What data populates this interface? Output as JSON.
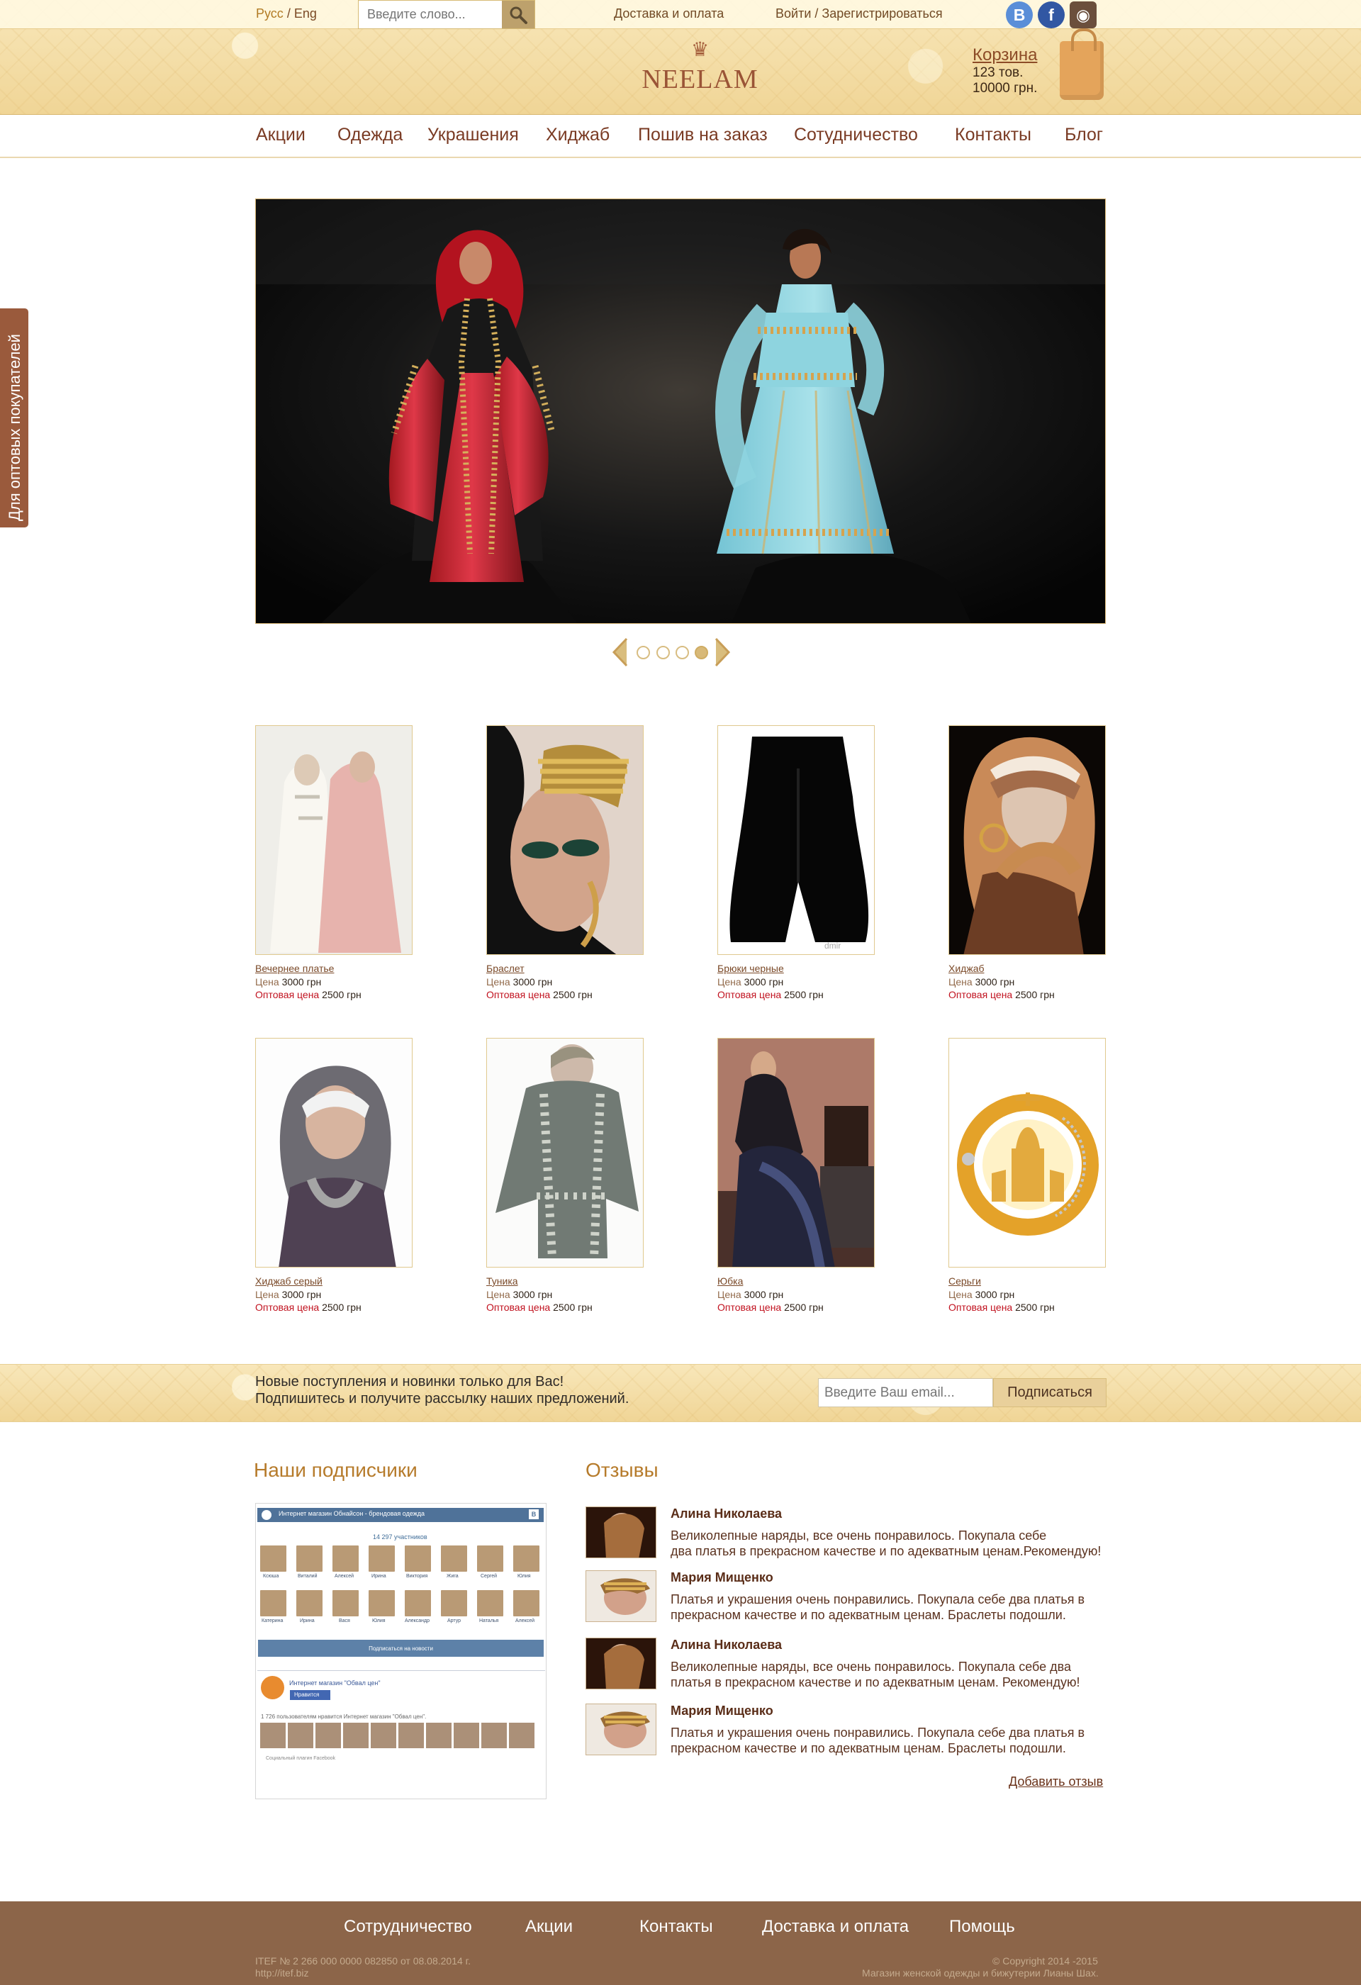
{
  "language": {
    "ru": "Русс",
    "separator": "/",
    "en": "Eng"
  },
  "search": {
    "placeholder": "Введите слово..."
  },
  "topbar": {
    "delivery": "Доставка и оплата",
    "auth": "Войти / Зарегистрироваться",
    "social": [
      {
        "label": "B",
        "color": "#5a8ed8"
      },
      {
        "label": "f",
        "color": "#3157a3"
      },
      {
        "label": "◉",
        "color": "#6b4f3c"
      }
    ]
  },
  "brand": {
    "name": "NEELAM",
    "crown_glyph": "♛"
  },
  "cart": {
    "title": "Корзина",
    "items": "123 тов.",
    "total": "10000 грн."
  },
  "nav": [
    "Акции",
    "Одежда",
    "Украшения",
    "Хиджаб",
    "Пошив на заказ",
    "Сотудничество",
    "Контакты",
    "Блог"
  ],
  "side_tab": {
    "label": "Для оптовых покупателей"
  },
  "slider": {
    "dots_count": 4,
    "active_index": 3
  },
  "product_labels": {
    "price": "Цена",
    "wholesale": "Оптовая цена"
  },
  "products": [
    {
      "name": "Вечернее платье",
      "price": "3000 грн",
      "wholesale_price": "2500 грн"
    },
    {
      "name": "Браслет",
      "price": "3000 грн",
      "wholesale_price": "2500 грн"
    },
    {
      "name": "Брюки черные",
      "price": "3000 грн",
      "wholesale_price": "2500 грн"
    },
    {
      "name": "Хиджаб",
      "price": "3000 грн",
      "wholesale_price": "2500 грн"
    },
    {
      "name": "Хиджаб серый",
      "price": "3000 грн",
      "wholesale_price": "2500 грн"
    },
    {
      "name": "Туника",
      "price": "3000 грн",
      "wholesale_price": "2500 грн"
    },
    {
      "name": "Юбка",
      "price": "3000 грн",
      "wholesale_price": "2500 грн"
    },
    {
      "name": "Серьги",
      "price": "3000 грн",
      "wholesale_price": "2500 грн"
    }
  ],
  "subscribe": {
    "line1": "Новые поступления и новинки только для Вас!",
    "line2": "Подпишитесь и получите рассылку наших предложений.",
    "placeholder": "Введите Ваш email...",
    "button": "Подписаться"
  },
  "subscribers": {
    "title": "Наши подписчики",
    "vk": {
      "title": "Интернет магазин Обнайсон - брендовая одежда",
      "count": "14 297 участников",
      "members": [
        "Ксюша",
        "Виталий",
        "Алексей",
        "Ирина",
        "Виктория",
        "Жига",
        "Сергей",
        "Юлия",
        "Катерина",
        "Ирина",
        "Вася",
        "Юлия",
        "Александр",
        "Артур",
        "Наталья",
        "Алексей"
      ],
      "button": "Подписаться на новости"
    },
    "fb": {
      "title": "Интернет магазин \"Обвал цен\"",
      "like": "Нравится",
      "count_text": "1 726 пользователям нравится Интернет магазин \"Обвал цен\".",
      "note": "Социальный плагин Facebook"
    }
  },
  "reviews": {
    "title": "Отзывы",
    "items": [
      {
        "author": "Алина Николаева",
        "text_lines": [
          "Великолепные наряды, все очень понравилось. Покупала себе",
          "два платья в прекрасном качестве и по адекватным ценам.Рекомендую!"
        ]
      },
      {
        "author": "Мария Мищенко",
        "text_lines": [
          "Платья и украшения очень понравились. Покупала себе два платья в",
          "прекрасном качестве и по адекватным ценам. Браслеты подошли."
        ]
      },
      {
        "author": "Алина Николаева",
        "text_lines": [
          "Великолепные наряды, все очень понравилось. Покупала себе два",
          "платья в прекрасном качестве и по адекватным ценам. Рекомендую!"
        ]
      },
      {
        "author": "Мария Мищенко",
        "text_lines": [
          "Платья и украшения очень понравились. Покупала себе два платья в",
          "прекрасном качестве и по адекватным ценам. Браслеты подошли."
        ]
      }
    ],
    "add": "Добавить отзыв"
  },
  "footer": {
    "nav": [
      "Сотрудничество",
      "Акции",
      "Контакты",
      "Доставка и оплата",
      "Помощь"
    ],
    "itef_lines": [
      "ITEF  № 2 266 000 0000 082850 от 08.08.2014 г.",
      "http://itef.biz"
    ],
    "copyright_lines": [
      "© Copyright 2014 -2015",
      "Магазин женской одежды и бижутерии Лианы Шах."
    ]
  },
  "colors": {
    "accent": "#b67b2b",
    "brown": "#7a3b24",
    "footer": "#8c6549",
    "gold": "#f0d596",
    "wholesale_red": "#c1121f"
  }
}
